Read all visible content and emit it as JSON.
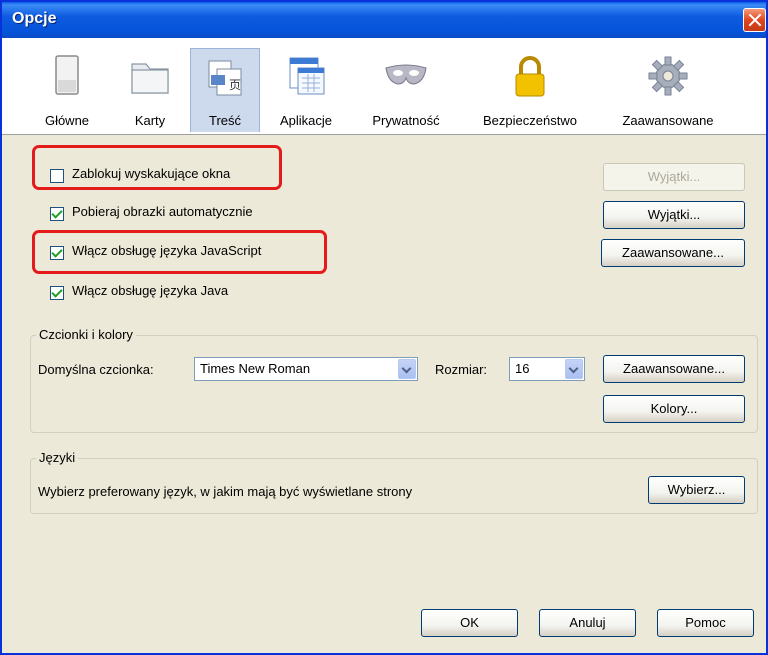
{
  "window": {
    "title": "Opcje"
  },
  "tabs": [
    {
      "label": "Główne",
      "icon": "window-icon"
    },
    {
      "label": "Karty",
      "icon": "tabs-folder-icon"
    },
    {
      "label": "Treść",
      "icon": "content-page-icon"
    },
    {
      "label": "Aplikacje",
      "icon": "applications-icon"
    },
    {
      "label": "Prywatność",
      "icon": "mask-icon"
    },
    {
      "label": "Bezpieczeństwo",
      "icon": "padlock-icon"
    },
    {
      "label": "Zaawansowane",
      "icon": "gear-icon"
    }
  ],
  "selected_tab": "Treść",
  "content": {
    "block_popups": {
      "label": "Zablokuj wyskakujące okna",
      "checked": false,
      "button": "Wyjątki..."
    },
    "load_images": {
      "label": "Pobieraj obrazki automatycznie",
      "checked": true,
      "button": "Wyjątki..."
    },
    "javascript": {
      "label": "Włącz obsługę języka JavaScript",
      "checked": true,
      "button": "Zaawansowane..."
    },
    "java": {
      "label": "Włącz obsługę języka Java",
      "checked": true
    }
  },
  "fonts": {
    "legend": "Czcionki i kolory",
    "default_font_label": "Domyślna czcionka:",
    "default_font_value": "Times New Roman",
    "size_label": "Rozmiar:",
    "size_value": "16",
    "advanced_button": "Zaawansowane...",
    "colors_button": "Kolory..."
  },
  "languages": {
    "legend": "Języki",
    "text": "Wybierz preferowany język, w jakim mają być wyświetlane strony",
    "choose_button": "Wybierz..."
  },
  "footer": {
    "ok": "OK",
    "cancel": "Anuluj",
    "help": "Pomoc"
  },
  "colors": {
    "titlebar": "#0553d8",
    "highlight": "#e31b1b",
    "dialog_bg": "#ece9d8"
  }
}
